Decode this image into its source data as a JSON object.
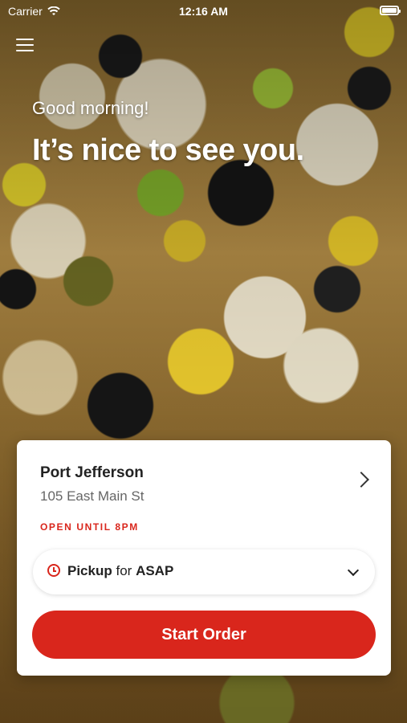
{
  "status_bar": {
    "carrier": "Carrier",
    "time": "12:16 AM"
  },
  "hero": {
    "greeting": "Good morning!",
    "headline": "It’s nice to see you."
  },
  "store": {
    "name": "Port Jefferson",
    "address": "105 East Main St",
    "hours": "OPEN UNTIL 8PM"
  },
  "order_mode": {
    "mode": "Pickup",
    "connector": "for",
    "when": "ASAP"
  },
  "actions": {
    "start_order": "Start Order"
  },
  "colors": {
    "accent": "#d9261c"
  }
}
